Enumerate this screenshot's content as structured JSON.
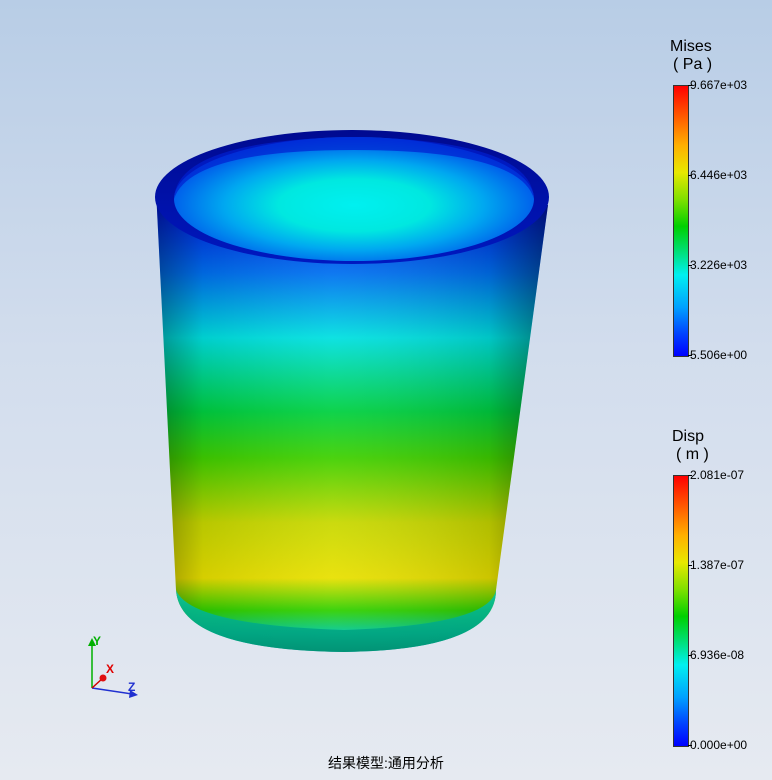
{
  "legends": {
    "mises": {
      "title": "Mises",
      "unit": "( Pa )",
      "ticks": [
        "9.667e+03",
        "6.446e+03",
        "3.226e+03",
        "5.506e+00"
      ]
    },
    "disp": {
      "title": "Disp",
      "unit": "( m )",
      "ticks": [
        "2.081e-07",
        "1.387e-07",
        "6.936e-08",
        "0.000e+00"
      ]
    }
  },
  "axes": {
    "x": "X",
    "y": "Y",
    "z": "Z"
  },
  "caption": "结果模型:通用分析",
  "colors": {
    "max": "#ff0000",
    "orange": "#ff8000",
    "yellow": "#e8e800",
    "green": "#00d000",
    "cyan": "#00f0f0",
    "blue": "#0050ff",
    "min": "#0000ff"
  }
}
